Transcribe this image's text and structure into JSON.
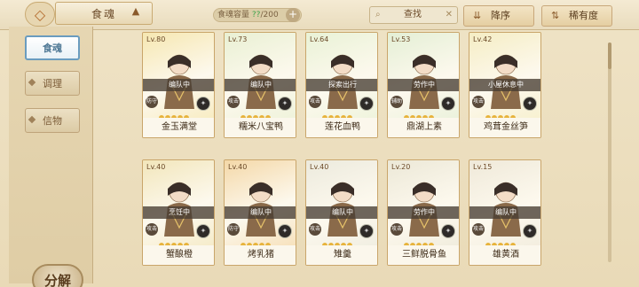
{
  "topbar": {
    "title": "食魂",
    "capacity_label": "食魂容量",
    "capacity_current": "??",
    "capacity_total": "/200",
    "search_label": "查找",
    "sort_label": "降序",
    "rarity_label": "稀有度"
  },
  "sidebar": {
    "tabs": [
      "食魂",
      "调理",
      "信物"
    ],
    "decompose_label": "分解"
  },
  "cards": [
    {
      "level": "Lv.80",
      "status": "编队中",
      "name": "金玉满堂",
      "tag": "防守",
      "color": "#f6e7b1"
    },
    {
      "level": "Lv.73",
      "status": "编队中",
      "name": "糯米八宝鸭",
      "tag": "攻击",
      "color": "#e9f0d3"
    },
    {
      "level": "Lv.64",
      "status": "探索出行",
      "name": "莲花血鸭",
      "tag": "攻击",
      "color": "#e9f2d6"
    },
    {
      "level": "Lv.53",
      "status": "劳作中",
      "name": "鼎湖上素",
      "tag": "辅助",
      "color": "#e4efd5"
    },
    {
      "level": "Lv.42",
      "status": "小屋休息中",
      "name": "鸡茸金丝笋",
      "tag": "攻击",
      "color": "#f5edc4"
    },
    {
      "level": "Lv.40",
      "status": "烹饪中",
      "name": "蟹酿橙",
      "tag": "攻击",
      "color": "#f2e6bb"
    },
    {
      "level": "Lv.40",
      "status": "编队中",
      "name": "烤乳猪",
      "tag": "防守",
      "color": "#f4d8a8"
    },
    {
      "level": "Lv.40",
      "status": "编队中",
      "name": "雉羹",
      "tag": "攻击",
      "color": "#eceadd"
    },
    {
      "level": "Lv.20",
      "status": "劳作中",
      "name": "三鲜脱骨鱼",
      "tag": "攻击",
      "color": "#ece8d7"
    },
    {
      "level": "Lv.15",
      "status": "编队中",
      "name": "雄黄酒",
      "tag": "攻击",
      "color": "#efe9d9"
    }
  ]
}
